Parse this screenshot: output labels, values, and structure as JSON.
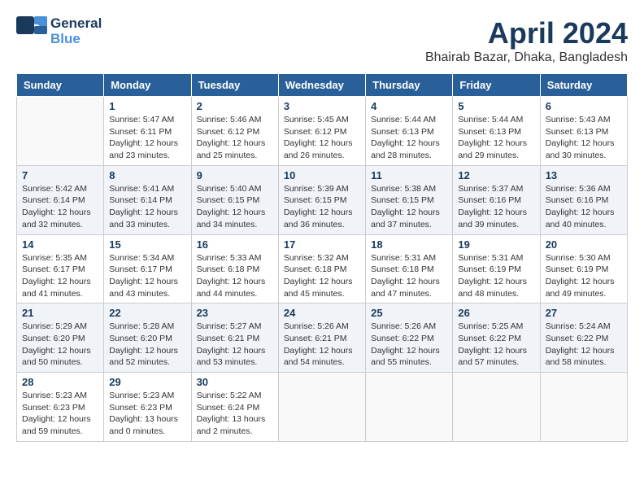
{
  "header": {
    "logo_line1": "General",
    "logo_line2": "Blue",
    "month": "April 2024",
    "location": "Bhairab Bazar, Dhaka, Bangladesh"
  },
  "days_of_week": [
    "Sunday",
    "Monday",
    "Tuesday",
    "Wednesday",
    "Thursday",
    "Friday",
    "Saturday"
  ],
  "weeks": [
    [
      {
        "num": "",
        "info": ""
      },
      {
        "num": "1",
        "info": "Sunrise: 5:47 AM\nSunset: 6:11 PM\nDaylight: 12 hours\nand 23 minutes."
      },
      {
        "num": "2",
        "info": "Sunrise: 5:46 AM\nSunset: 6:12 PM\nDaylight: 12 hours\nand 25 minutes."
      },
      {
        "num": "3",
        "info": "Sunrise: 5:45 AM\nSunset: 6:12 PM\nDaylight: 12 hours\nand 26 minutes."
      },
      {
        "num": "4",
        "info": "Sunrise: 5:44 AM\nSunset: 6:13 PM\nDaylight: 12 hours\nand 28 minutes."
      },
      {
        "num": "5",
        "info": "Sunrise: 5:44 AM\nSunset: 6:13 PM\nDaylight: 12 hours\nand 29 minutes."
      },
      {
        "num": "6",
        "info": "Sunrise: 5:43 AM\nSunset: 6:13 PM\nDaylight: 12 hours\nand 30 minutes."
      }
    ],
    [
      {
        "num": "7",
        "info": "Sunrise: 5:42 AM\nSunset: 6:14 PM\nDaylight: 12 hours\nand 32 minutes."
      },
      {
        "num": "8",
        "info": "Sunrise: 5:41 AM\nSunset: 6:14 PM\nDaylight: 12 hours\nand 33 minutes."
      },
      {
        "num": "9",
        "info": "Sunrise: 5:40 AM\nSunset: 6:15 PM\nDaylight: 12 hours\nand 34 minutes."
      },
      {
        "num": "10",
        "info": "Sunrise: 5:39 AM\nSunset: 6:15 PM\nDaylight: 12 hours\nand 36 minutes."
      },
      {
        "num": "11",
        "info": "Sunrise: 5:38 AM\nSunset: 6:15 PM\nDaylight: 12 hours\nand 37 minutes."
      },
      {
        "num": "12",
        "info": "Sunrise: 5:37 AM\nSunset: 6:16 PM\nDaylight: 12 hours\nand 39 minutes."
      },
      {
        "num": "13",
        "info": "Sunrise: 5:36 AM\nSunset: 6:16 PM\nDaylight: 12 hours\nand 40 minutes."
      }
    ],
    [
      {
        "num": "14",
        "info": "Sunrise: 5:35 AM\nSunset: 6:17 PM\nDaylight: 12 hours\nand 41 minutes."
      },
      {
        "num": "15",
        "info": "Sunrise: 5:34 AM\nSunset: 6:17 PM\nDaylight: 12 hours\nand 43 minutes."
      },
      {
        "num": "16",
        "info": "Sunrise: 5:33 AM\nSunset: 6:18 PM\nDaylight: 12 hours\nand 44 minutes."
      },
      {
        "num": "17",
        "info": "Sunrise: 5:32 AM\nSunset: 6:18 PM\nDaylight: 12 hours\nand 45 minutes."
      },
      {
        "num": "18",
        "info": "Sunrise: 5:31 AM\nSunset: 6:18 PM\nDaylight: 12 hours\nand 47 minutes."
      },
      {
        "num": "19",
        "info": "Sunrise: 5:31 AM\nSunset: 6:19 PM\nDaylight: 12 hours\nand 48 minutes."
      },
      {
        "num": "20",
        "info": "Sunrise: 5:30 AM\nSunset: 6:19 PM\nDaylight: 12 hours\nand 49 minutes."
      }
    ],
    [
      {
        "num": "21",
        "info": "Sunrise: 5:29 AM\nSunset: 6:20 PM\nDaylight: 12 hours\nand 50 minutes."
      },
      {
        "num": "22",
        "info": "Sunrise: 5:28 AM\nSunset: 6:20 PM\nDaylight: 12 hours\nand 52 minutes."
      },
      {
        "num": "23",
        "info": "Sunrise: 5:27 AM\nSunset: 6:21 PM\nDaylight: 12 hours\nand 53 minutes."
      },
      {
        "num": "24",
        "info": "Sunrise: 5:26 AM\nSunset: 6:21 PM\nDaylight: 12 hours\nand 54 minutes."
      },
      {
        "num": "25",
        "info": "Sunrise: 5:26 AM\nSunset: 6:22 PM\nDaylight: 12 hours\nand 55 minutes."
      },
      {
        "num": "26",
        "info": "Sunrise: 5:25 AM\nSunset: 6:22 PM\nDaylight: 12 hours\nand 57 minutes."
      },
      {
        "num": "27",
        "info": "Sunrise: 5:24 AM\nSunset: 6:22 PM\nDaylight: 12 hours\nand 58 minutes."
      }
    ],
    [
      {
        "num": "28",
        "info": "Sunrise: 5:23 AM\nSunset: 6:23 PM\nDaylight: 12 hours\nand 59 minutes."
      },
      {
        "num": "29",
        "info": "Sunrise: 5:23 AM\nSunset: 6:23 PM\nDaylight: 13 hours\nand 0 minutes."
      },
      {
        "num": "30",
        "info": "Sunrise: 5:22 AM\nSunset: 6:24 PM\nDaylight: 13 hours\nand 2 minutes."
      },
      {
        "num": "",
        "info": ""
      },
      {
        "num": "",
        "info": ""
      },
      {
        "num": "",
        "info": ""
      },
      {
        "num": "",
        "info": ""
      }
    ]
  ]
}
